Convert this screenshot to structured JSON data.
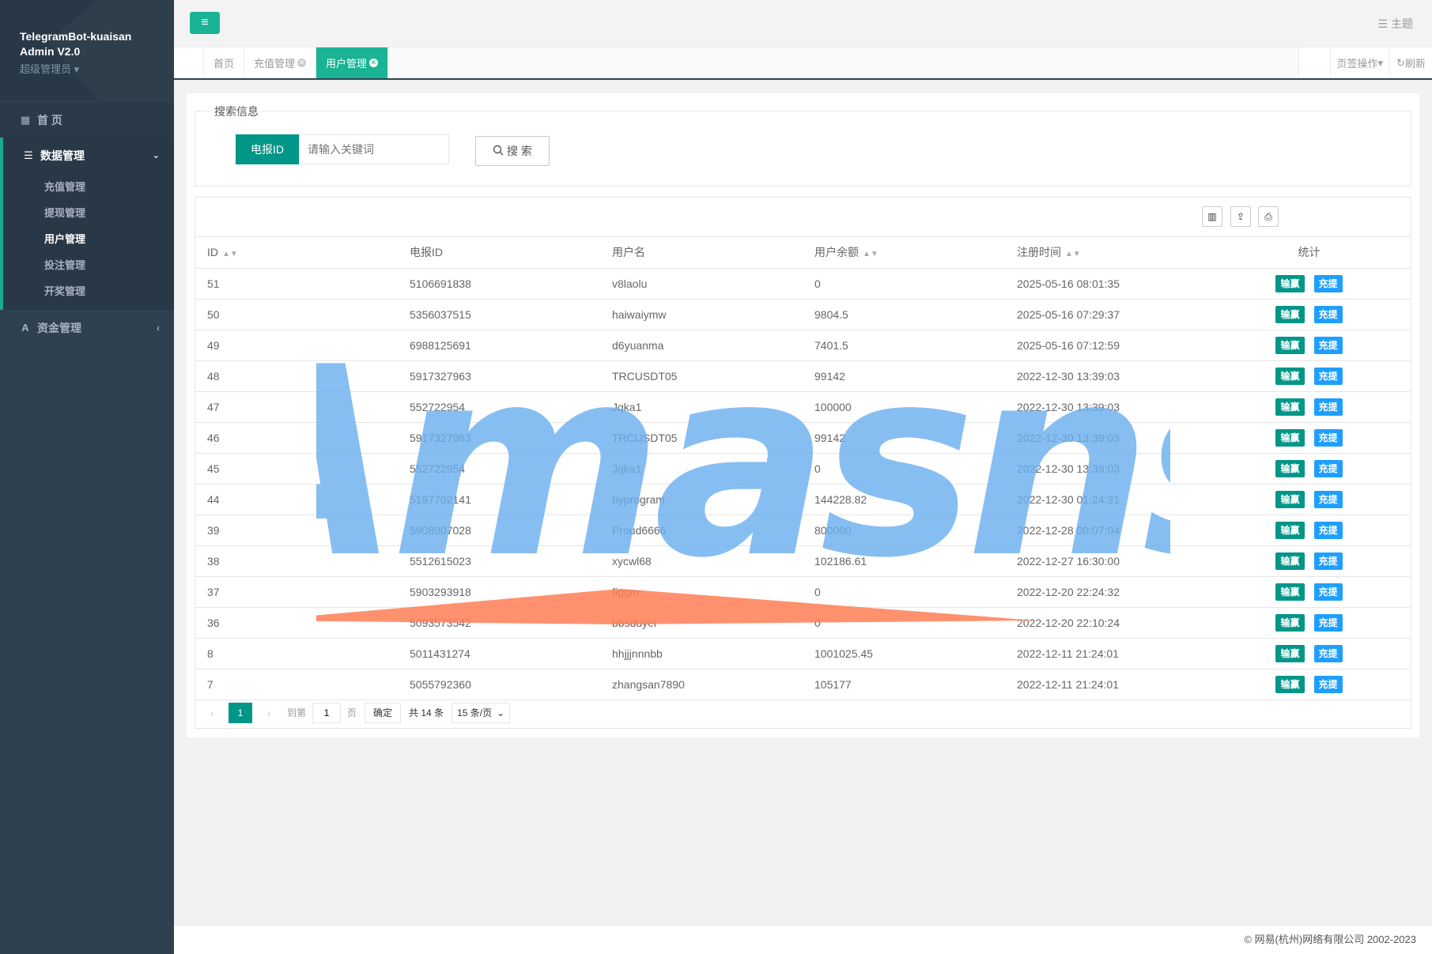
{
  "sidebar": {
    "app_title_line1": "TelegramBot-kuaisan",
    "app_title_line2": "Admin V2.0",
    "role": "超级管理员",
    "home": "首 页",
    "group": "数据管理",
    "sub_items": [
      "充值管理",
      "提现管理",
      "用户管理",
      "投注管理",
      "开奖管理"
    ],
    "active_sub": "用户管理",
    "fund": "资金管理"
  },
  "topbar": {
    "theme": "主题"
  },
  "tabs": {
    "items": [
      {
        "label": "首页",
        "closable": false
      },
      {
        "label": "充值管理",
        "closable": true
      },
      {
        "label": "用户管理",
        "closable": true,
        "active": true
      }
    ],
    "page_ops": "页签操作",
    "refresh": "刷新"
  },
  "search": {
    "legend": "搜索信息",
    "label": "电报ID",
    "placeholder": "请输入关键词",
    "button": "搜 索"
  },
  "table": {
    "columns": [
      "ID",
      "电报ID",
      "用户名",
      "用户余额",
      "注册时间",
      "统计"
    ],
    "rows": [
      {
        "id": "51",
        "tgid": "5106691838",
        "name": "v8laolu",
        "balance": "0",
        "time": "2025-05-16 08:01:35"
      },
      {
        "id": "50",
        "tgid": "5356037515",
        "name": "haiwaiymw",
        "balance": "9804.5",
        "time": "2025-05-16 07:29:37"
      },
      {
        "id": "49",
        "tgid": "6988125691",
        "name": "d6yuanma",
        "balance": "7401.5",
        "time": "2025-05-16 07:12:59"
      },
      {
        "id": "48",
        "tgid": "5917327963",
        "name": "TRCUSDT05",
        "balance": "99142",
        "time": "2022-12-30 13:39:03"
      },
      {
        "id": "47",
        "tgid": "552722954",
        "name": "Jqka1",
        "balance": "100000",
        "time": "2022-12-30 13:39:03"
      },
      {
        "id": "46",
        "tgid": "5917327963",
        "name": "TRCUSDT05",
        "balance": "99142",
        "time": "2022-12-30 13:39:03"
      },
      {
        "id": "45",
        "tgid": "552722954",
        "name": "Jqka1",
        "balance": "0",
        "time": "2022-12-30 13:39:03"
      },
      {
        "id": "44",
        "tgid": "5197702141",
        "name": "byprogram",
        "balance": "144228.82",
        "time": "2022-12-30 01:24:31"
      },
      {
        "id": "39",
        "tgid": "5908907028",
        "name": "Proud6666",
        "balance": "800000",
        "time": "2022-12-28 00:07:04"
      },
      {
        "id": "38",
        "tgid": "5512615023",
        "name": "xycwl68",
        "balance": "102186.61",
        "time": "2022-12-27 16:30:00"
      },
      {
        "id": "37",
        "tgid": "5903293918",
        "name": "figgm",
        "balance": "0",
        "time": "2022-12-20 22:24:32"
      },
      {
        "id": "36",
        "tgid": "5093573542",
        "name": "bbsduyei",
        "balance": "0",
        "time": "2022-12-20 22:10:24"
      },
      {
        "id": "8",
        "tgid": "5011431274",
        "name": "hhjjjnnnbb",
        "balance": "1001025.45",
        "time": "2022-12-11 21:24:01"
      },
      {
        "id": "7",
        "tgid": "5055792360",
        "name": "zhangsan7890",
        "balance": "105177",
        "time": "2022-12-11 21:24:01"
      }
    ],
    "op_win": "输赢",
    "op_rec": "充提"
  },
  "pager": {
    "current": "1",
    "goto_prefix": "到第",
    "goto_value": "1",
    "goto_suffix": "页",
    "ok": "确定",
    "total": "共 14 条",
    "per_page": "15 条/页"
  },
  "footer": {
    "copyright": "© 网易(杭州)网络有限公司 2002-2023"
  },
  "watermark": {
    "text": "Amasns"
  },
  "colors": {
    "sidebar_bg": "#2f4050",
    "accent": "#1ab394",
    "primary": "#009688",
    "blue": "#1e9fff",
    "watermark_blue": "#6aaef0",
    "watermark_orange": "#ff7e55"
  }
}
